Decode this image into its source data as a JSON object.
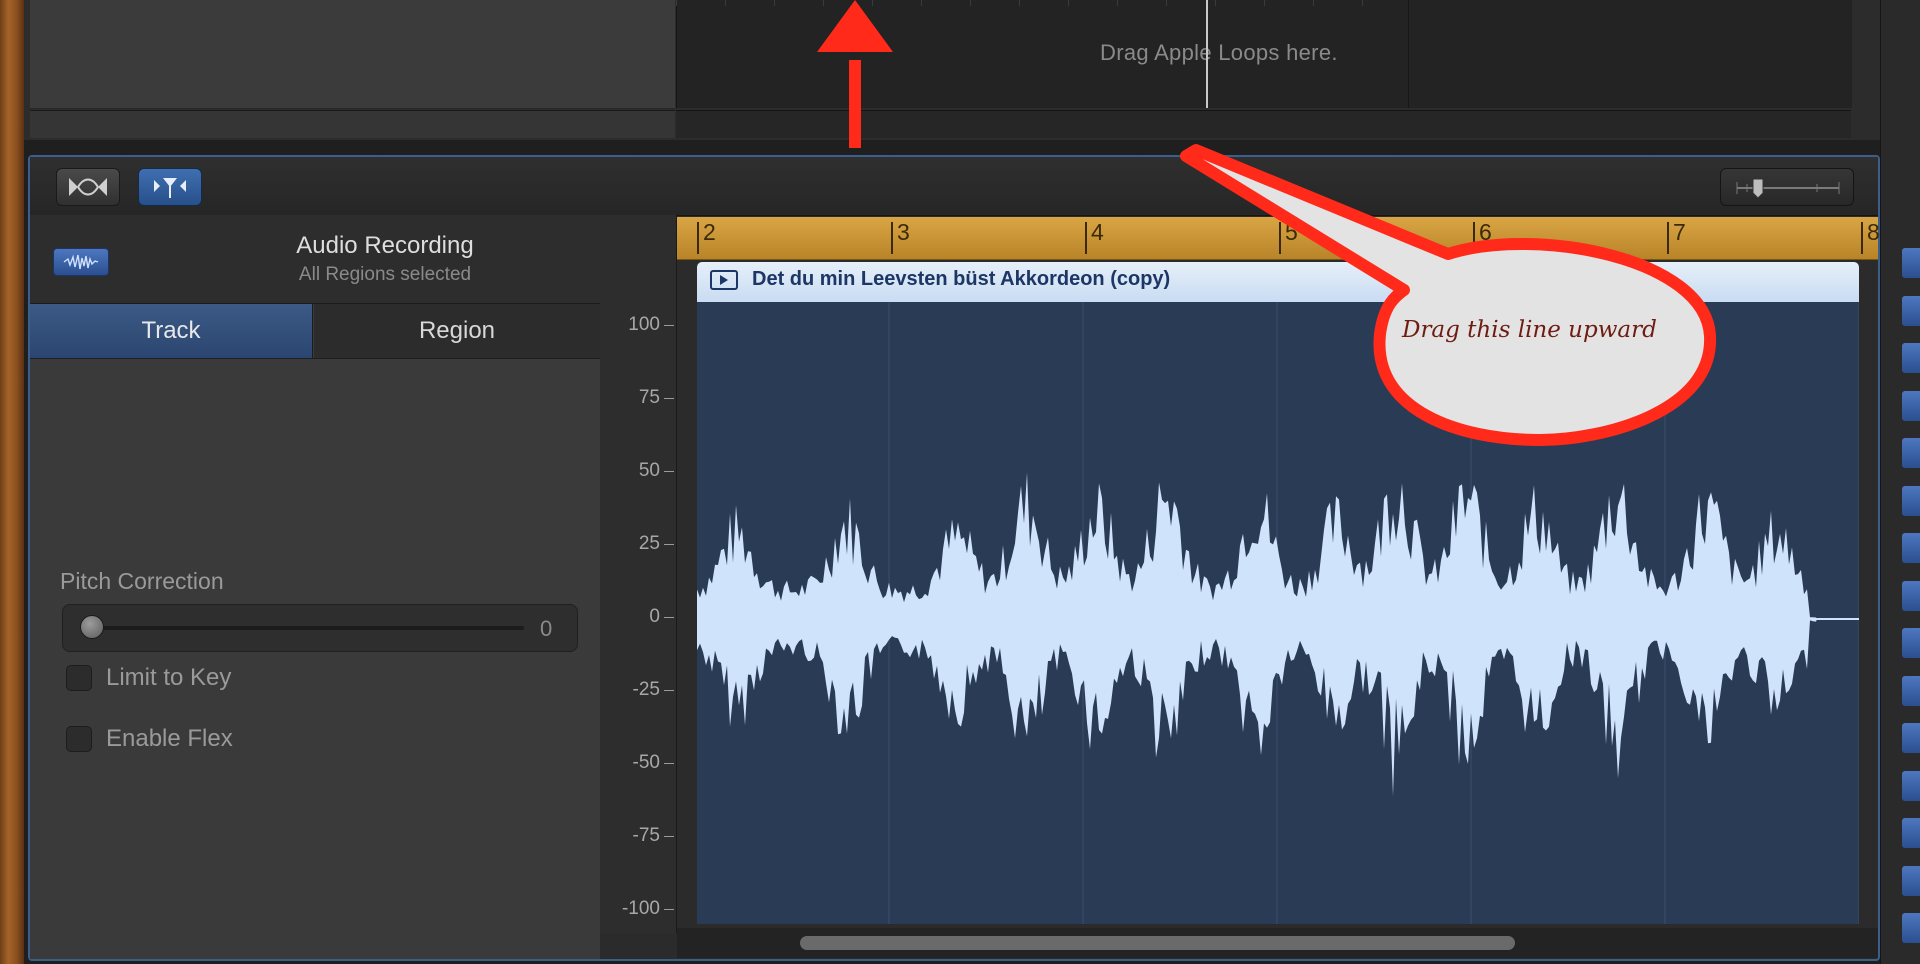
{
  "top_tracks": {
    "loops_hint": "Drag Apple Loops here."
  },
  "editor": {
    "inspector": {
      "title": "Audio Recording",
      "subtitle": "All Regions selected",
      "tabs": [
        "Track",
        "Region"
      ],
      "active_tab": "Track",
      "pitch_correction": {
        "label": "Pitch Correction",
        "value": "0"
      },
      "checkboxes": [
        {
          "label": "Limit to Key",
          "checked": false
        },
        {
          "label": "Enable Flex",
          "checked": false
        }
      ]
    },
    "amplitude_scale": [
      "100",
      "75",
      "50",
      "25",
      "0",
      "-25",
      "-50",
      "-75",
      "-100"
    ],
    "ruler": [
      "2",
      "3",
      "4",
      "5",
      "6",
      "7",
      "8"
    ],
    "region": {
      "name": "Det du min Leevsten büst Akkordeon (copy)"
    }
  },
  "annotation": {
    "callout": "Drag this line upward",
    "arrow_color": "#ff2a1a"
  },
  "colors": {
    "accent_blue": "#3f6fb0",
    "ruler_gold": "#d9a544",
    "waveform": "#cfe3fb",
    "region_bg": "#2a3b56"
  }
}
